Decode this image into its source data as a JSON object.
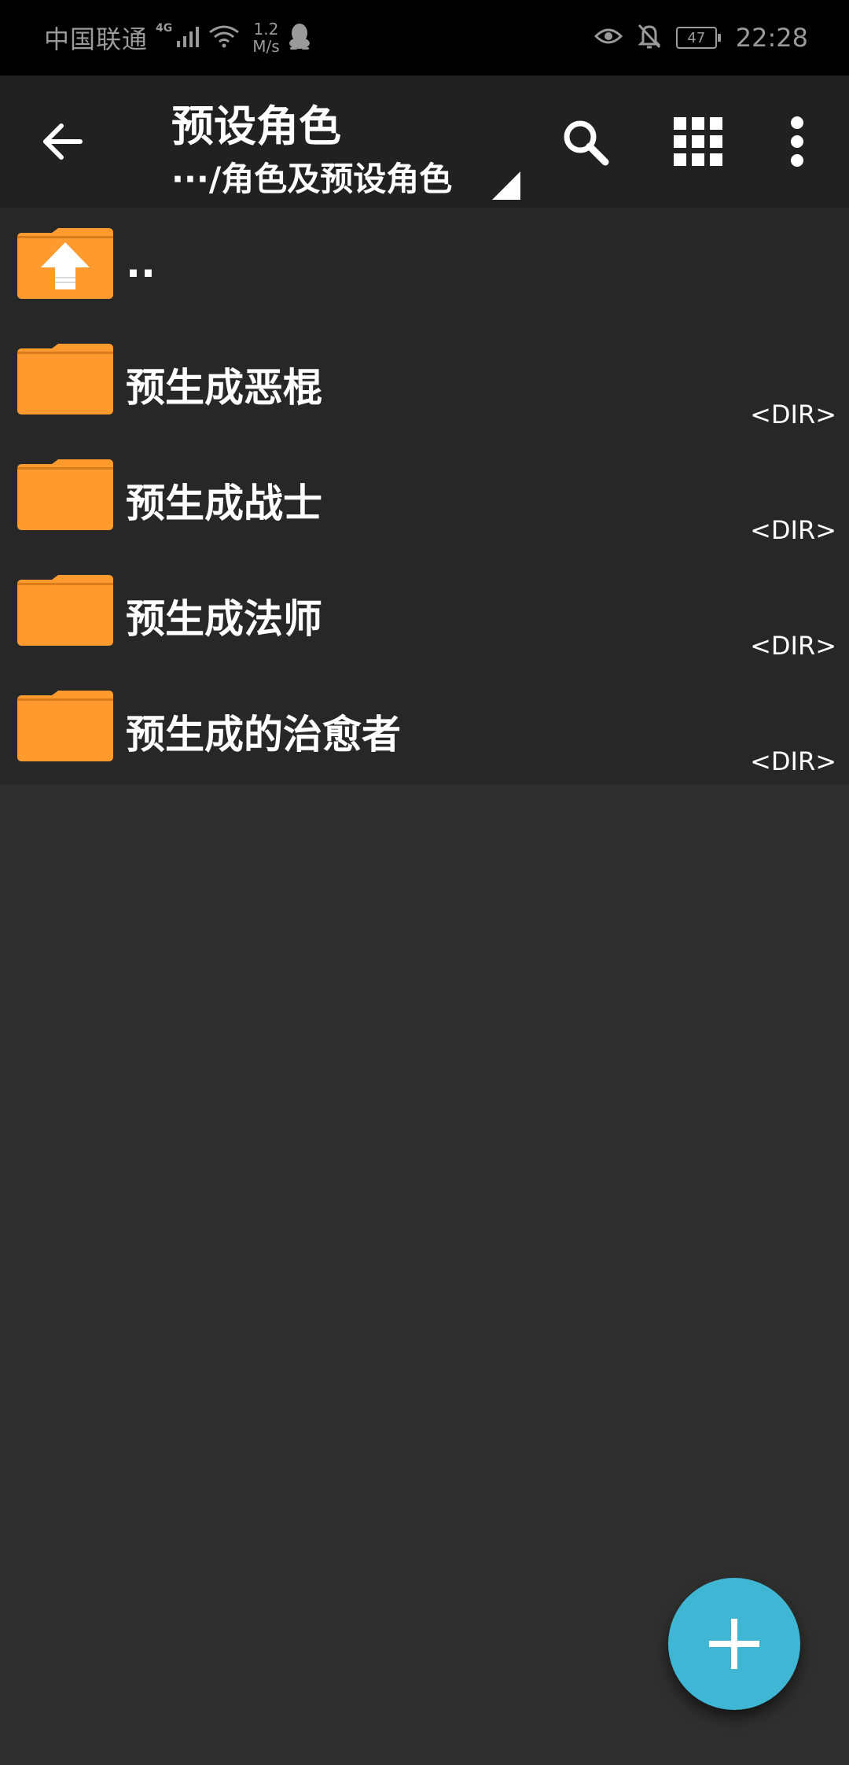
{
  "status_bar": {
    "carrier": "中国联通",
    "network_type": "4G",
    "speed_value": "1.2",
    "speed_unit": "M/s",
    "battery": "47",
    "time": "22:28"
  },
  "toolbar": {
    "title": "预设角色",
    "path": "···/角色及预设角色"
  },
  "files": [
    {
      "name": "..",
      "type": "",
      "icon": "parent-folder-icon"
    },
    {
      "name": "预生成恶棍",
      "type": "<DIR>",
      "icon": "folder-icon"
    },
    {
      "name": "预生成战士",
      "type": "<DIR>",
      "icon": "folder-icon"
    },
    {
      "name": "预生成法师",
      "type": "<DIR>",
      "icon": "folder-icon"
    },
    {
      "name": "预生成的治愈者",
      "type": "<DIR>",
      "icon": "folder-icon"
    }
  ],
  "colors": {
    "folder": "#FF9A2E",
    "fab": "#3FB6D3",
    "toolbar": "#212121",
    "background": "#2F2F2F"
  }
}
